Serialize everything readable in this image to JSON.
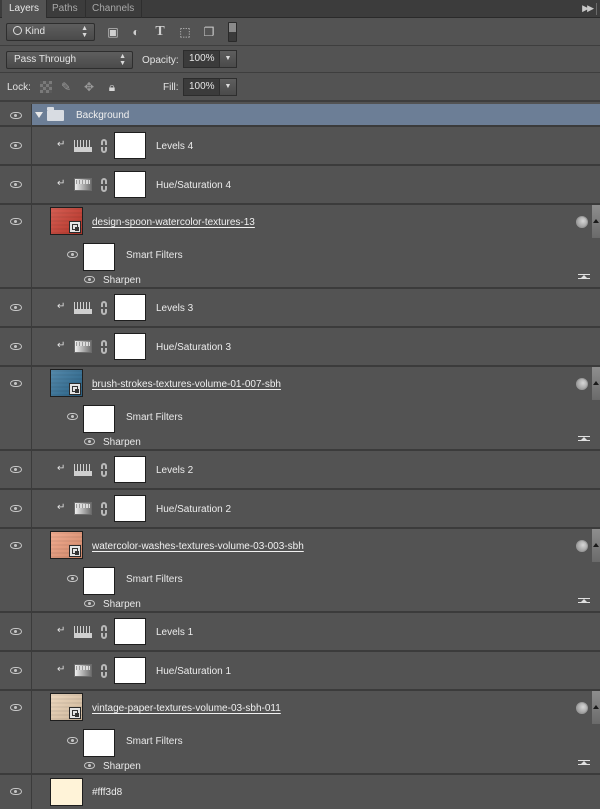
{
  "tabs": [
    {
      "label": "Layers",
      "active": true
    },
    {
      "label": "Paths",
      "active": false
    },
    {
      "label": "Channels",
      "active": false
    }
  ],
  "panel_menu_icon": "double-chevron-right-icon",
  "filter": {
    "kind_label": "Kind",
    "filter_icons": [
      "image-filter-icon",
      "adjustment-filter-icon",
      "type-filter-icon",
      "shape-filter-icon",
      "smart-object-filter-icon"
    ],
    "toggle_state": "off"
  },
  "blend": {
    "mode": "Pass Through",
    "opacity_label": "Opacity:",
    "opacity_value": "100%"
  },
  "lock": {
    "label": "Lock:",
    "icons": [
      "lock-transparent-icon",
      "lock-paint-icon",
      "lock-position-icon",
      "lock-all-icon"
    ],
    "fill_label": "Fill:",
    "fill_value": "100%"
  },
  "layers": {
    "group": {
      "name": "Background",
      "expanded": true,
      "selected": true,
      "color": "#6c7e96"
    },
    "items": [
      {
        "type": "adjustment",
        "kind": "levels",
        "name": "Levels 4",
        "clipped": true
      },
      {
        "type": "adjustment",
        "kind": "hue",
        "name": "Hue/Saturation 4",
        "clipped": true
      },
      {
        "type": "smart",
        "name": "design-spoon-watercolor-textures-13",
        "thumb_color": "#cc3b2e",
        "smart_filters_label": "Smart Filters",
        "filter_name": "Sharpen"
      },
      {
        "type": "adjustment",
        "kind": "levels",
        "name": "Levels 3",
        "clipped": true
      },
      {
        "type": "adjustment",
        "kind": "hue",
        "name": "Hue/Saturation 3",
        "clipped": true
      },
      {
        "type": "smart",
        "name": "brush-strokes-textures-volume-01-007-sbh",
        "thumb_color": "#2f6f98",
        "smart_filters_label": "Smart Filters",
        "filter_name": "Sharpen"
      },
      {
        "type": "adjustment",
        "kind": "levels",
        "name": "Levels 2",
        "clipped": true
      },
      {
        "type": "adjustment",
        "kind": "hue",
        "name": "Hue/Saturation 2",
        "clipped": true
      },
      {
        "type": "smart",
        "name": "watercolor-washes-textures-volume-03-003-sbh",
        "thumb_color": "#ee9a78",
        "smart_filters_label": "Smart Filters",
        "filter_name": "Sharpen"
      },
      {
        "type": "adjustment",
        "kind": "levels",
        "name": "Levels 1",
        "clipped": true
      },
      {
        "type": "adjustment",
        "kind": "hue",
        "name": "Hue/Saturation 1",
        "clipped": true
      },
      {
        "type": "smart",
        "name": "vintage-paper-textures-volume-03-sbh-011",
        "thumb_color": "#e9cfb0",
        "smart_filters_label": "Smart Filters",
        "filter_name": "Sharpen"
      },
      {
        "type": "fill",
        "name": "#fff3d8",
        "thumb_color": "#fff3d8"
      }
    ]
  }
}
